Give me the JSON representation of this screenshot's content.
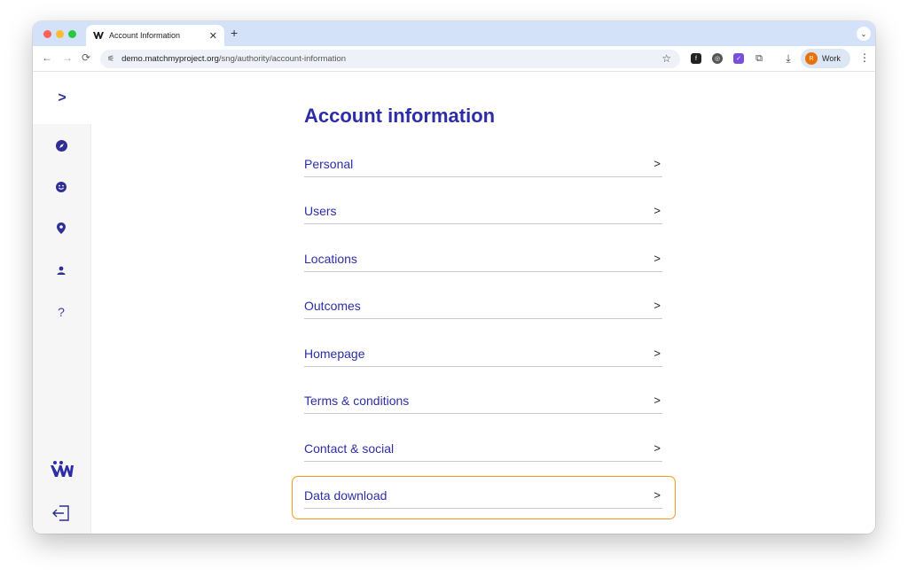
{
  "browser": {
    "tab_title": "Account Information",
    "new_tab_symbol": "+",
    "url_host": "demo.matchmyproject.org",
    "url_path": "/sng/authority/account-information",
    "profile_initial": "R",
    "profile_label": "Work"
  },
  "sidebar": {
    "toggle_symbol": ">",
    "help_symbol": "?"
  },
  "page": {
    "title": "Account information",
    "items": [
      {
        "label": "Personal"
      },
      {
        "label": "Users"
      },
      {
        "label": "Locations"
      },
      {
        "label": "Outcomes"
      },
      {
        "label": "Homepage"
      },
      {
        "label": "Terms & conditions"
      },
      {
        "label": "Contact & social"
      },
      {
        "label": "Data download"
      }
    ],
    "chevron": ">"
  },
  "colors": {
    "brand": "#2d2da8",
    "highlight": "#f29a19",
    "tabbar": "#d3e2f8"
  }
}
